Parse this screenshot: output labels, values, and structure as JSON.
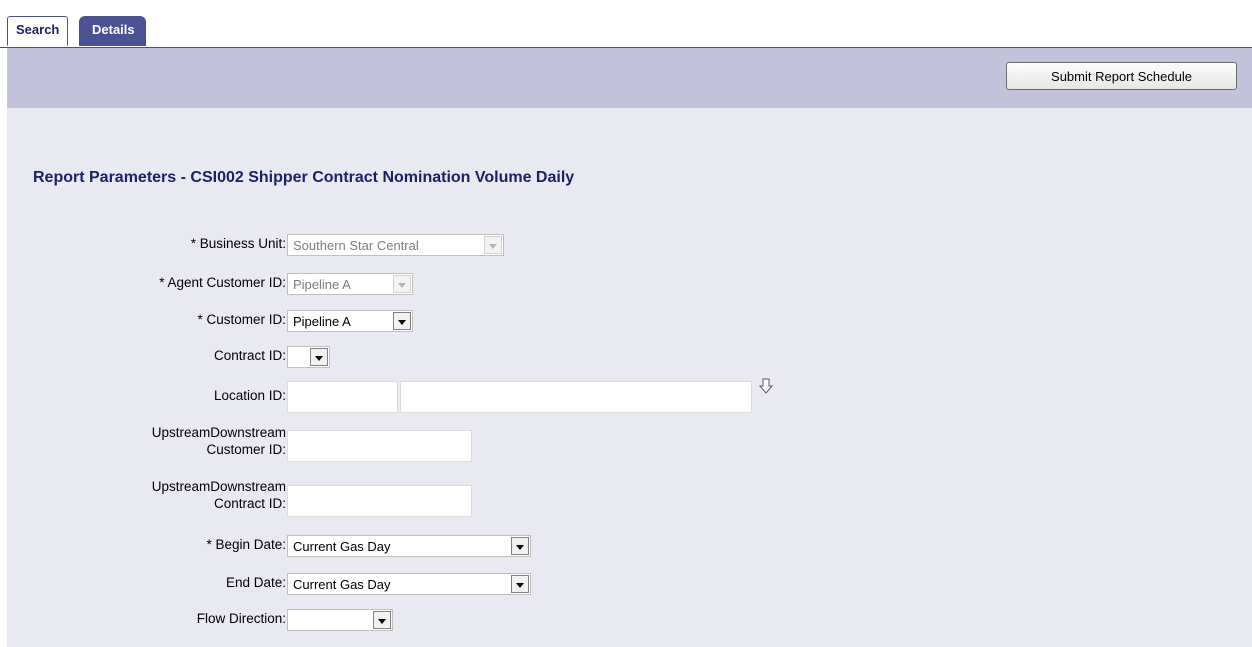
{
  "tabs": {
    "search": "Search",
    "details": "Details"
  },
  "toolbar": {
    "submit_label": "Submit Report Schedule"
  },
  "page": {
    "title": "Report Parameters - CSI002 Shipper Contract Nomination Volume Daily"
  },
  "form": {
    "business_unit": {
      "label": "* Business Unit:",
      "value": "Southern Star Central"
    },
    "agent_customer_id": {
      "label": "* Agent Customer ID:",
      "value": "Pipeline A"
    },
    "customer_id": {
      "label": "* Customer ID:",
      "value": "Pipeline A"
    },
    "contract_id": {
      "label": "Contract ID:",
      "value": ""
    },
    "location_id": {
      "label": "Location ID:",
      "code_value": "",
      "name_value": ""
    },
    "updown_customer_id": {
      "label_line1": "UpstreamDownstream",
      "label_line2": "Customer ID:",
      "value": ""
    },
    "updown_contract_id": {
      "label_line1": "UpstreamDownstream",
      "label_line2": "Contract ID:",
      "value": ""
    },
    "begin_date": {
      "label": "* Begin Date:",
      "value": "Current Gas Day"
    },
    "end_date": {
      "label": "End Date:",
      "value": "Current Gas Day"
    },
    "flow_direction": {
      "label": "Flow Direction:",
      "value": ""
    }
  },
  "colors": {
    "tab_active_bg": "#4a5295",
    "toolbar_bg": "#c3c3dd",
    "content_bg": "#e9e9f2",
    "title_color": "#1a2266"
  },
  "icons": {
    "lookup": "down-arrow-outline-icon",
    "dropdown": "chevron-down-icon"
  }
}
